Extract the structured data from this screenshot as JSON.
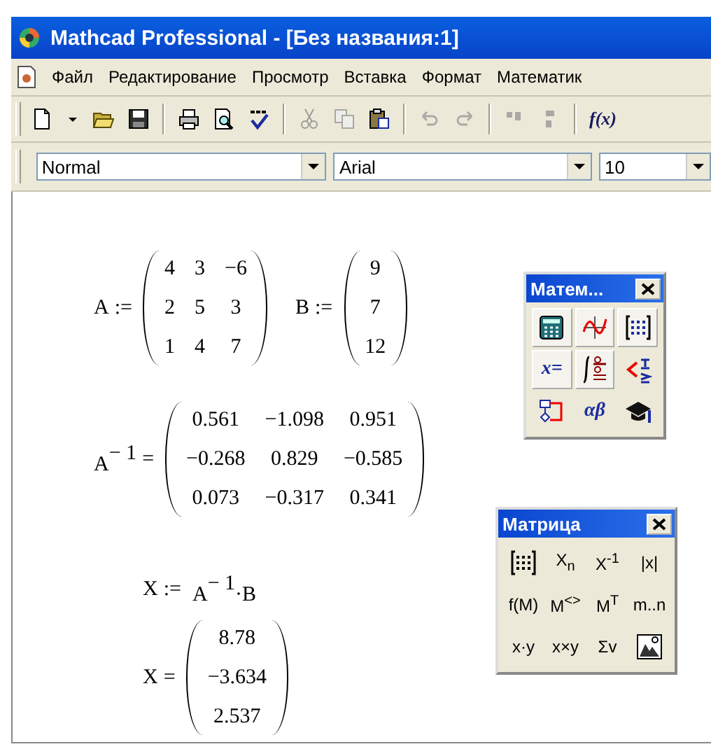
{
  "window": {
    "title": "Mathcad Professional - [Без названия:1]"
  },
  "menu": [
    "Файл",
    "Редактирование",
    "Просмотр",
    "Вставка",
    "Формат",
    "Математик"
  ],
  "toolbar": [
    {
      "kind": "button",
      "disabled": false
    },
    {
      "kind": "dropdown",
      "disabled": false
    },
    {
      "kind": "button",
      "disabled": false
    },
    {
      "kind": "button",
      "disabled": false
    },
    {
      "kind": "separator"
    },
    {
      "kind": "button",
      "disabled": false
    },
    {
      "kind": "button",
      "disabled": false
    },
    {
      "kind": "button",
      "disabled": false
    },
    {
      "kind": "separator"
    },
    {
      "kind": "button",
      "disabled": true
    },
    {
      "kind": "button",
      "disabled": true
    },
    {
      "kind": "button",
      "disabled": false
    },
    {
      "kind": "separator"
    },
    {
      "kind": "button",
      "disabled": true
    },
    {
      "kind": "button",
      "disabled": true
    },
    {
      "kind": "separator"
    },
    {
      "kind": "button",
      "disabled": true
    },
    {
      "kind": "button",
      "disabled": true
    },
    {
      "kind": "separator"
    },
    {
      "kind": "text",
      "label": "f(x)",
      "disabled": false
    }
  ],
  "format_bar": {
    "style": "Normal",
    "font": "Arial",
    "size": "10"
  },
  "worksheet": [
    {
      "kind": "matrix",
      "lhs": "A",
      "op": ":=",
      "rows": [
        [
          "4",
          "3",
          "−6"
        ],
        [
          "2",
          "5",
          "3"
        ],
        [
          "1",
          "4",
          "7"
        ]
      ]
    },
    {
      "kind": "matrix",
      "lhs": "B",
      "op": ":=",
      "rows": [
        [
          "9"
        ],
        [
          "7"
        ],
        [
          "12"
        ]
      ]
    },
    {
      "kind": "matrix",
      "lhs": "A$^{− 1}$",
      "op": "=",
      "rows": [
        [
          "0.561",
          "−1.098",
          "0.951"
        ],
        [
          "−0.268",
          "0.829",
          "−0.585"
        ],
        [
          "0.073",
          "−0.317",
          "0.341"
        ]
      ]
    },
    {
      "kind": "expression",
      "lhs": "X",
      "op": ":=",
      "rhs": "A$^{− 1}$·B"
    },
    {
      "kind": "matrix",
      "lhs": "X",
      "op": "=",
      "rows": [
        [
          "8.78"
        ],
        [
          "−3.634"
        ],
        [
          "2.537"
        ]
      ]
    }
  ],
  "palettes": [
    {
      "title": "Матем...",
      "buttons": [
        {
          "kind": "icon",
          "pressed": true
        },
        {
          "kind": "icon",
          "pressed": true
        },
        {
          "kind": "icon",
          "pressed": true
        },
        {
          "kind": "glyph",
          "label": "x=",
          "pressed": true
        },
        {
          "kind": "icon",
          "pressed": true
        },
        {
          "kind": "icon",
          "pressed": false
        },
        {
          "kind": "icon",
          "pressed": false
        },
        {
          "kind": "glyph",
          "label": "αβ",
          "pressed": false
        },
        {
          "kind": "icon",
          "pressed": false
        }
      ]
    },
    {
      "title": "Матрица",
      "buttons": [
        {
          "kind": "icon",
          "pressed": false
        },
        {
          "kind": "glyph",
          "label": "X$_{n}$",
          "pressed": false
        },
        {
          "kind": "glyph",
          "label": "X$^{-1}$",
          "pressed": false
        },
        {
          "kind": "glyph",
          "label": "|x|",
          "pressed": false
        },
        {
          "kind": "glyph",
          "label": "f(M)",
          "pressed": false
        },
        {
          "kind": "glyph",
          "label": "M$^{<>}$",
          "pressed": false
        },
        {
          "kind": "glyph",
          "label": "M$^{T}$",
          "pressed": false
        },
        {
          "kind": "glyph",
          "label": "m..n",
          "pressed": false
        },
        {
          "kind": "glyph",
          "label": "x·y",
          "pressed": false
        },
        {
          "kind": "glyph",
          "label": "x×y",
          "pressed": false
        },
        {
          "kind": "glyph",
          "label": "Σv",
          "pressed": false
        },
        {
          "kind": "icon",
          "pressed": false
        }
      ]
    }
  ]
}
